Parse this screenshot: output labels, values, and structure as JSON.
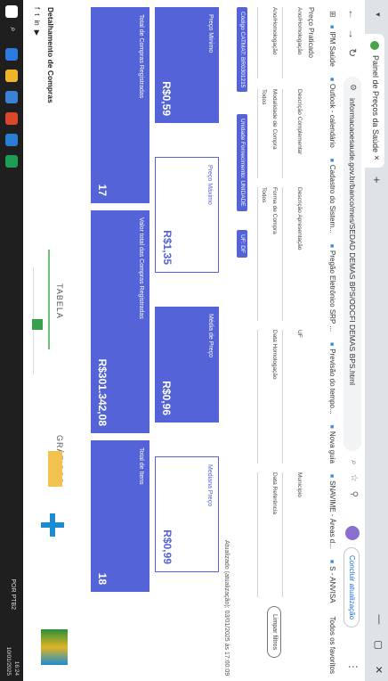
{
  "browser": {
    "tab_title": "Painel de Preços da Saúde",
    "tab_close": "×",
    "new_tab": "+",
    "url": "informacaoesaude.gov.br/banco/mes/SEDAD DEMAS BPS/ODCFI DEMAS BPS.html",
    "update_button": "Concluir atualização",
    "bookmarks": [
      "IPM Saúde",
      "Outlook - calendário",
      "Cadastro do Sistem...",
      "Pregão Eletrônico SRP ...",
      "Previsão do tempo...",
      "Nova guia",
      "SNAVIME - Áreas d...",
      "S - ANVISA"
    ],
    "other_bookmarks": "Todos os favoritos"
  },
  "page": {
    "title": "Preço Praticado",
    "filters": [
      {
        "label": "Ano/Homologação",
        "value": ""
      },
      {
        "label": "Ano/Homologação",
        "value": ""
      },
      {
        "label": "Descrição Complementar",
        "value": ""
      },
      {
        "label": "Descrição Apresentação",
        "value": ""
      },
      {
        "label": "UF",
        "value": ""
      },
      {
        "label": "Município",
        "value": ""
      },
      {
        "label": "Modalidade de Compra",
        "value": "Todos"
      },
      {
        "label": "Modalidade de Compra",
        "value": "Todos"
      },
      {
        "label": "Forma de Compra",
        "value": "Todos"
      },
      {
        "label": "Data Homologação",
        "value": ""
      },
      {
        "label": "Data Referência",
        "value": ""
      }
    ],
    "chips": [
      "Código CATMAT: BR0301215",
      "Unidade Fornecimento: UNIDADE",
      "UF: DF"
    ],
    "clear_button": "Limpar filtros",
    "updated": "Atualizado (atualização): 03/01/2025 às 17:00:09",
    "stats": {
      "min_label": "Preço Mínimo",
      "min_value": "R$0,59",
      "max_label": "Preço Máximo",
      "max_value": "R$1,35",
      "avg_label": "Média de Preço",
      "avg_value": "R$0,96",
      "median_label": "Mediana Preço",
      "median_value": "R$0,99",
      "total_purchases_label": "Total de Compras Registradas",
      "total_purchases_value": "17",
      "total_value_label": "Valor total das Compras Registradas",
      "total_value_value": "R$301.342,08",
      "total_items_label": "Total de Itens",
      "total_items_value": "18"
    },
    "view_tabs": [
      "TABELA",
      "GRÁFICOS"
    ],
    "details_title": "Detalhamento de Compras",
    "social": [
      "f",
      "t",
      "in",
      "▶"
    ]
  },
  "taskbar": {
    "time": "16:24",
    "date": "10/01/2025",
    "lang": "POR PTB2"
  }
}
